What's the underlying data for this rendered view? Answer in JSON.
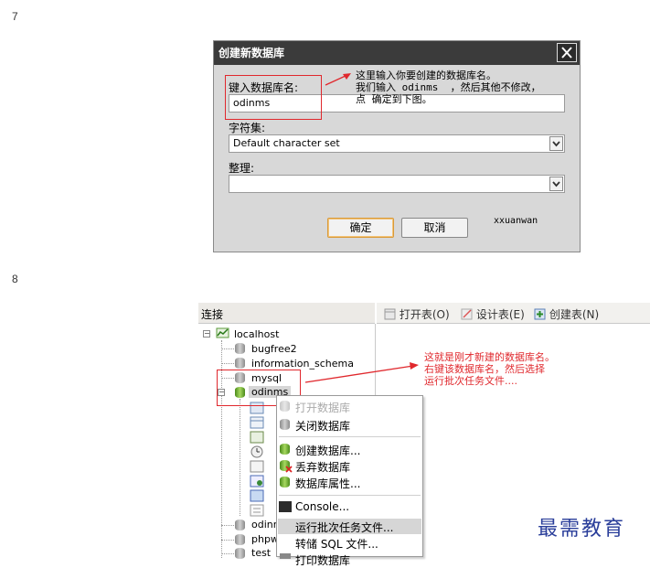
{
  "steps": [
    "7",
    "8"
  ],
  "dialog": {
    "title": "创建新数据库",
    "name_label": "键入数据库名:",
    "name_value": "odinms",
    "charset_label": "字符集:",
    "charset_value": "Default character set",
    "collation_label": "整理:",
    "collation_value": "",
    "ok_label": "确定",
    "cancel_label": "取消",
    "corner_text": "xxuanwan"
  },
  "annotation1": {
    "line1": "这里输入你要创建的数据库名。",
    "line2": "我们输入 odinms  ，然后其他不修改，",
    "line3": "点 确定到下图。"
  },
  "navicat": {
    "connection_header": "连接",
    "toolbar": {
      "open_table": "打开表(O)",
      "design_table": "设计表(E)",
      "create_table": "创建表(N)"
    },
    "tree": {
      "root": "localhost",
      "databases": [
        "bugfree2",
        "information_schema",
        "mysql",
        "odinms"
      ],
      "below": [
        "odinn",
        "phpw",
        "test"
      ]
    },
    "context_menu": {
      "items": [
        "打开数据库",
        "关闭数据库",
        "创建数据库...",
        "丢弃数据库",
        "数据库属性...",
        "Console...",
        "运行批次任务文件...",
        "转储 SQL 文件...",
        "打印数据库"
      ]
    }
  },
  "annotation2": {
    "line1": "这就是刚才新建的数据库名。",
    "line2": "右键该数据库名，然后选择",
    "line3": "运行批次任务文件...."
  },
  "watermark": "最需教育",
  "colors": {
    "annotation_red": "#e0282d",
    "watermark_blue": "#2a3e9a",
    "titlebar": "#3b3b3b"
  }
}
